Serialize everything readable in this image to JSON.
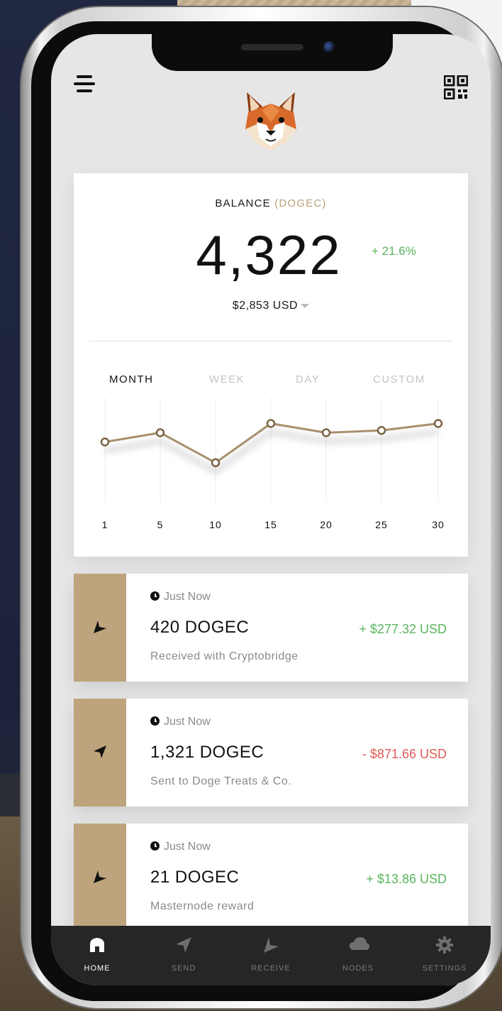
{
  "colors": {
    "accent": "#bda47c",
    "positive": "#5ab55e",
    "negative": "#e05a55",
    "nav_bg": "#262626"
  },
  "header": {
    "menu_icon": "hamburger-menu-icon",
    "qr_icon": "qr-code-icon",
    "avatar_icon": "shiba-inu-avatar"
  },
  "balance": {
    "label": "BALANCE",
    "unit": "(DOGEC)",
    "amount": "4,322",
    "change": "+ 21.6%",
    "usd": "$2,853 USD"
  },
  "tabs": [
    {
      "label": "MONTH",
      "active": true
    },
    {
      "label": "WEEK",
      "active": false
    },
    {
      "label": "DAY",
      "active": false
    },
    {
      "label": "CUSTOM",
      "active": false
    }
  ],
  "chart_data": {
    "type": "line",
    "x": [
      "1",
      "5",
      "10",
      "15",
      "20",
      "25",
      "30"
    ],
    "values": [
      2.2,
      2.6,
      1.3,
      3.0,
      2.6,
      2.7,
      3.0
    ],
    "ylim": [
      0,
      4
    ],
    "grid": "vertical",
    "title": "",
    "xlabel": "",
    "ylabel": ""
  },
  "transactions": [
    {
      "time": "Just Now",
      "amount": "420 DOGEC",
      "usd": "+ $277.32 USD",
      "direction": "in",
      "desc": "Received with Cryptobridge",
      "icon": "receive-arrow-icon"
    },
    {
      "time": "Just Now",
      "amount": "1,321 DOGEC",
      "usd": "- $871.66 USD",
      "direction": "out",
      "desc": "Sent to Doge Treats & Co.",
      "icon": "send-arrow-icon"
    },
    {
      "time": "Just Now",
      "amount": "21 DOGEC",
      "usd": "+ $13.86 USD",
      "direction": "in",
      "desc": "Masternode reward",
      "icon": "receive-arrow-icon"
    }
  ],
  "nav": [
    {
      "label": "HOME",
      "icon": "home-icon",
      "active": true
    },
    {
      "label": "SEND",
      "icon": "send-icon",
      "active": false
    },
    {
      "label": "RECEIVE",
      "icon": "receive-icon",
      "active": false
    },
    {
      "label": "NODES",
      "icon": "cloud-icon",
      "active": false
    },
    {
      "label": "SETTINGS",
      "icon": "gear-icon",
      "active": false
    }
  ]
}
